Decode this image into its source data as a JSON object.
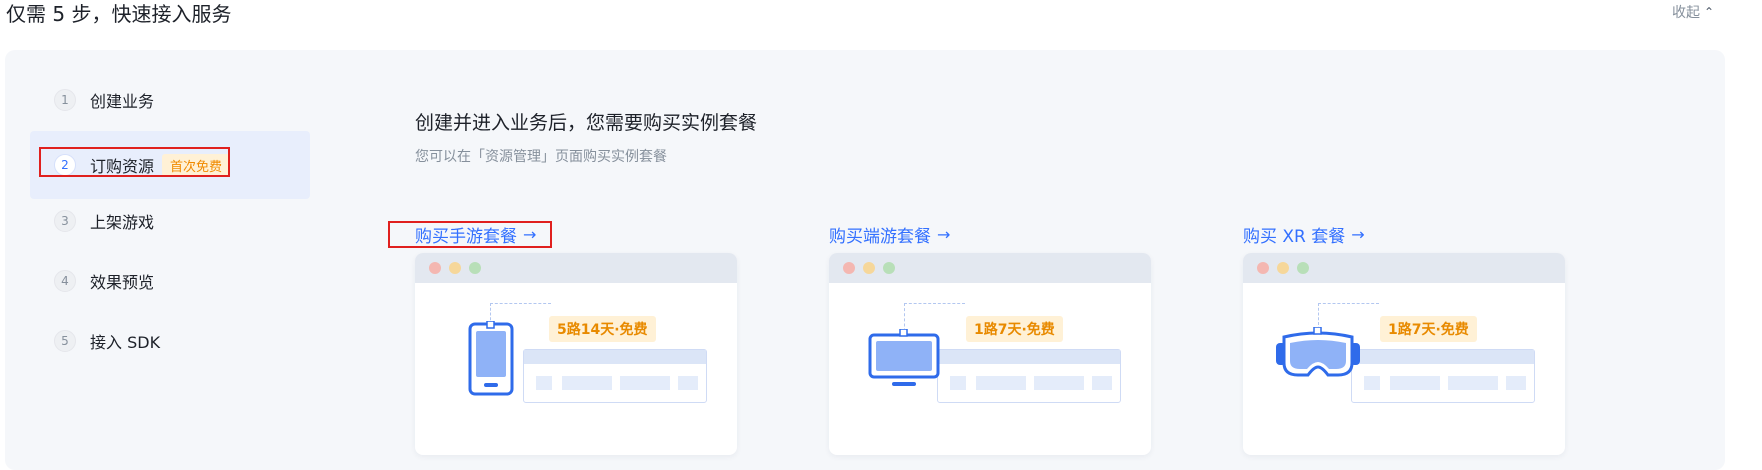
{
  "header": {
    "title": "仅需 5 步，快速接入服务",
    "collapse_label": "收起",
    "collapse_icon": "chevron-up-icon"
  },
  "steps": [
    {
      "num": "1",
      "label": "创建业务"
    },
    {
      "num": "2",
      "label": "订购资源",
      "badge": "首次免费",
      "active": true
    },
    {
      "num": "3",
      "label": "上架游戏"
    },
    {
      "num": "4",
      "label": "效果预览"
    },
    {
      "num": "5",
      "label": "接入 SDK"
    }
  ],
  "content": {
    "title": "创建并进入业务后，您需要购买实例套餐",
    "subtitle": "您可以在「资源管理」页面购买实例套餐"
  },
  "packages": [
    {
      "link": "购买手游套餐",
      "price": "5路14天·免费",
      "device_icon": "phone-icon"
    },
    {
      "link": "购买端游套餐",
      "price": "1路7天·免费",
      "device_icon": "monitor-icon"
    },
    {
      "link": "购买 XR 套餐",
      "price": "1路7天·免费",
      "device_icon": "vr-headset-icon"
    }
  ],
  "colors": {
    "accent": "#3370ff",
    "badge_bg": "#fff1d6",
    "badge_text": "#f08a00",
    "highlight_box": "#e0201e"
  }
}
